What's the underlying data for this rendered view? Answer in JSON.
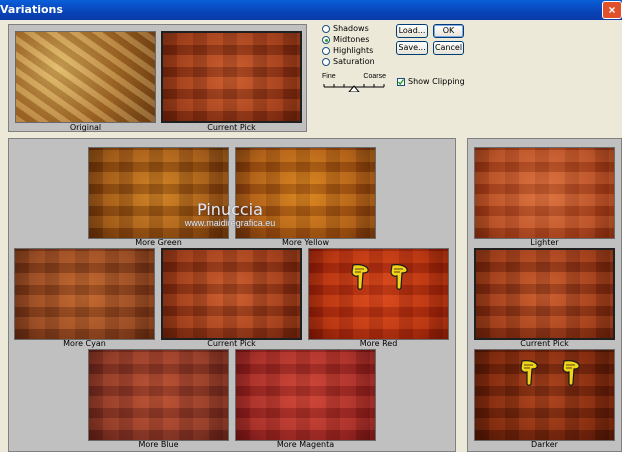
{
  "window": {
    "title": "Variations",
    "close_glyph": "×"
  },
  "top": {
    "original_label": "Original",
    "current_pick_label": "Current Pick"
  },
  "tone": {
    "options": [
      "Shadows",
      "Midtones",
      "Highlights",
      "Saturation"
    ],
    "selected": "Midtones",
    "fine_label": "Fine",
    "coarse_label": "Coarse",
    "slider_position": 0.5
  },
  "buttons": {
    "load": "Load...",
    "ok": "OK",
    "save": "Save...",
    "cancel": "Cancel"
  },
  "show_clipping": {
    "label": "Show Clipping",
    "checked": true
  },
  "variations": {
    "more_green": "More Green",
    "more_yellow": "More Yellow",
    "more_cyan": "More Cyan",
    "current_pick": "Current Pick",
    "more_red": "More Red",
    "more_blue": "More Blue",
    "more_magenta": "More Magenta"
  },
  "brightness": {
    "lighter": "Lighter",
    "current_pick": "Current Pick",
    "darker": "Darker"
  },
  "watermark": {
    "name": "Pinuccia",
    "url": "www.maidiregrafica.eu"
  }
}
